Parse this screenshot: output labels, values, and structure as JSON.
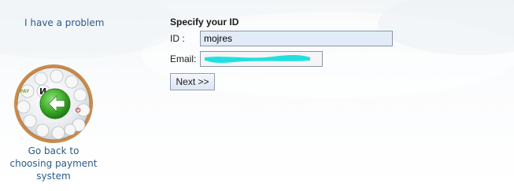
{
  "left_panel": {
    "problem_link": "I have a problem",
    "back_label": "Go back to choosing payment system"
  },
  "form": {
    "title": "Specify your ID",
    "id_label": "ID :",
    "id_value": "mojres",
    "email_label": "Email:",
    "submit_label": "Next >>"
  },
  "colors": {
    "link": "#2c5a8c",
    "redaction": "#1fe0e0",
    "badge_ring": "#c98a4c",
    "back_arrow": "#3fae2a"
  }
}
